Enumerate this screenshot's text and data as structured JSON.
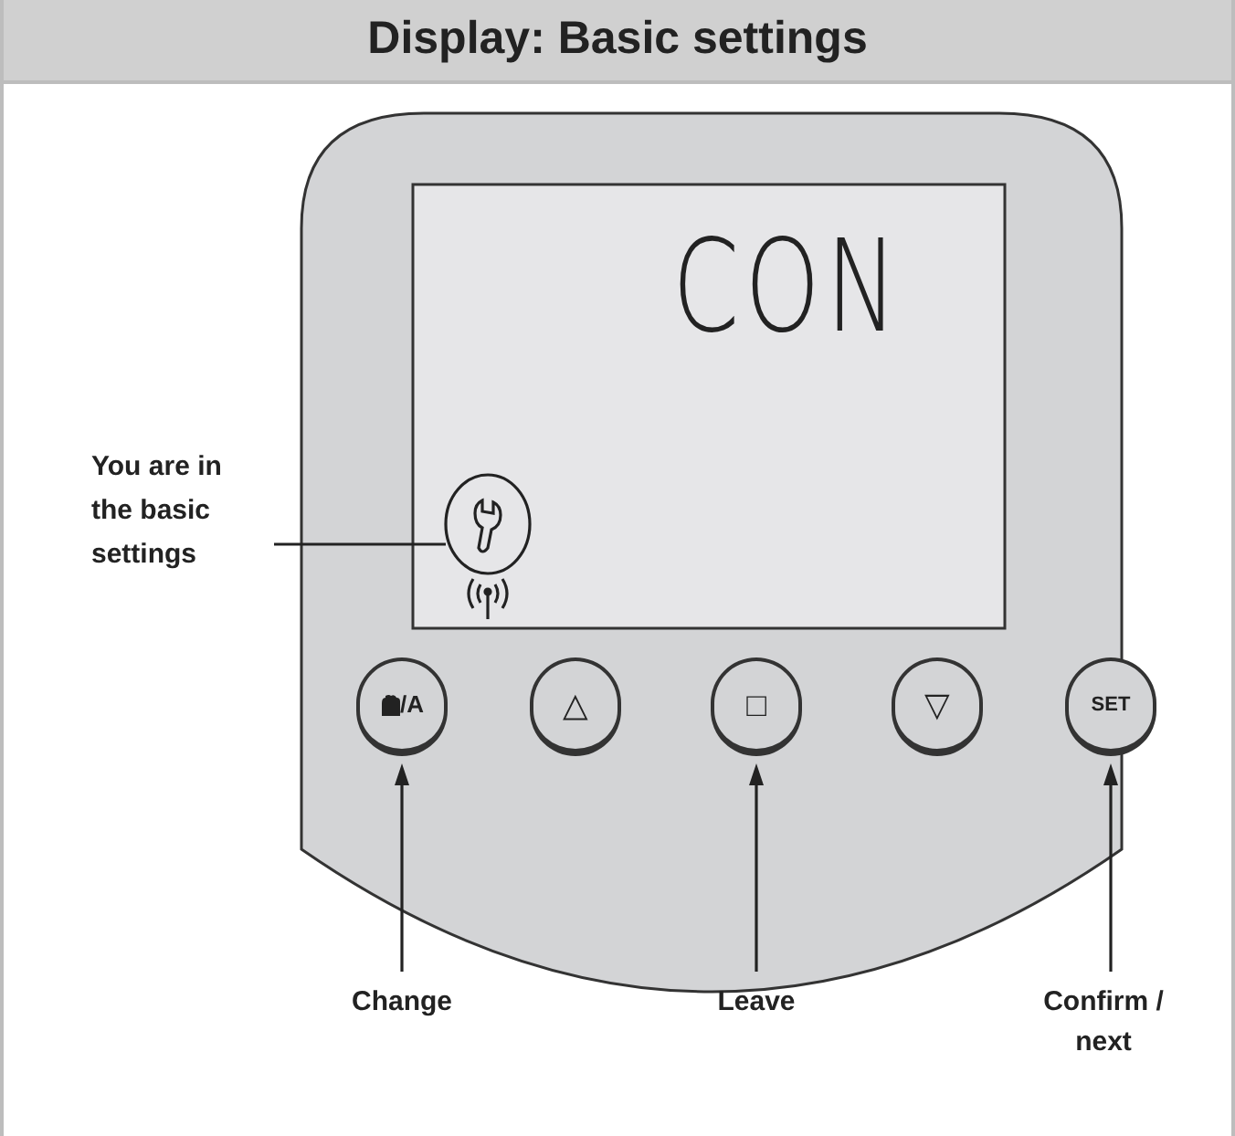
{
  "header": {
    "title": "Display: Basic settings"
  },
  "display": {
    "lcd_text": "CON"
  },
  "icon_callout": {
    "text": "You are in the basic settings"
  },
  "buttons": [
    {
      "kind": "hand",
      "label": "/A",
      "caption": "Change"
    },
    {
      "kind": "glyph",
      "label": "△"
    },
    {
      "kind": "glyph",
      "label": "□",
      "caption": "Leave"
    },
    {
      "kind": "glyph",
      "label": "▽"
    },
    {
      "kind": "text",
      "label": "SET",
      "caption": "Confirm / next"
    }
  ]
}
